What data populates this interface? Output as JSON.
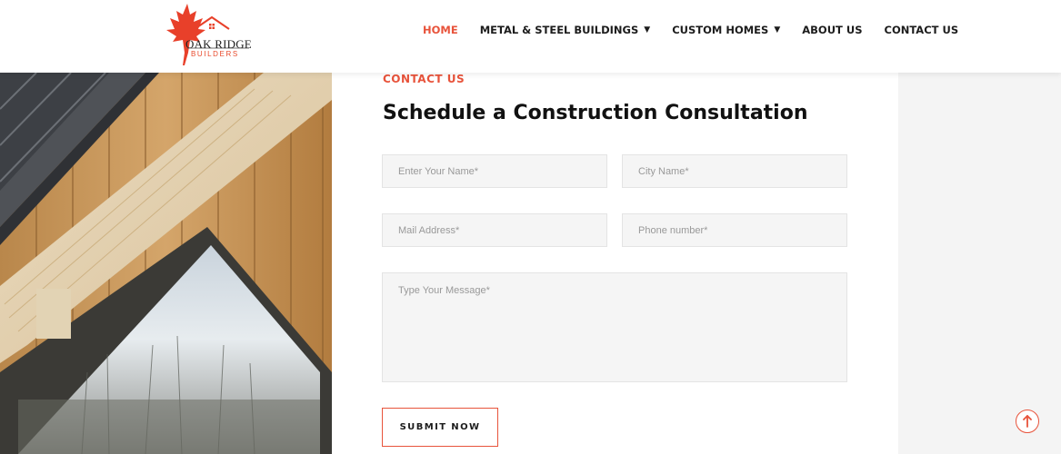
{
  "brand": {
    "name": "OAK RIDGE",
    "sub": "BUILDERS",
    "accent": "#e8533b"
  },
  "nav": {
    "items": [
      {
        "label": "HOME",
        "active": true,
        "has_dropdown": false
      },
      {
        "label": "METAL & STEEL BUILDINGS",
        "active": false,
        "has_dropdown": true
      },
      {
        "label": "CUSTOM HOMES",
        "active": false,
        "has_dropdown": true
      },
      {
        "label": "ABOUT US",
        "active": false,
        "has_dropdown": false
      },
      {
        "label": "CONTACT US",
        "active": false,
        "has_dropdown": false
      }
    ],
    "dropdown_glyph": "▼"
  },
  "contact": {
    "eyebrow": "CONTACT US",
    "title": "Schedule a Construction Consultation",
    "fields": {
      "name_placeholder": "Enter Your Name*",
      "city_placeholder": "City Name*",
      "mail_placeholder": "Mail Address*",
      "phone_placeholder": "Phone number*",
      "message_placeholder": "Type Your Message*"
    },
    "submit_label": "SUBMIT NOW"
  },
  "icons": {
    "logo": "maple-leaf-house-logo",
    "scroll_top": "arrow-up-icon"
  }
}
